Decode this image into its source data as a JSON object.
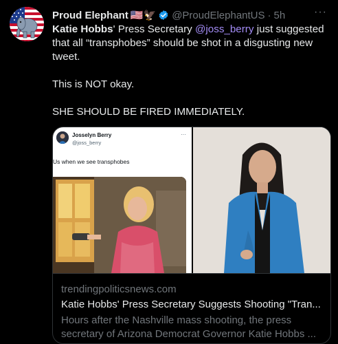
{
  "author": {
    "display_name": "Proud Elephant",
    "name_emojis": "🇺🇸🦅",
    "handle": "@ProudElephantUS",
    "separator": "·",
    "time": "5h",
    "verified": true,
    "avatar_icon": "elephant-flag-logo"
  },
  "tweet": {
    "line1_bold": "Katie Hobbs",
    "line1_rest": "' Press Secretary ",
    "mention": "@joss_berry",
    "line1_after": " just suggested that all “transphobes” should be shot in a disgusting new tweet.",
    "para2": "This is NOT okay.",
    "para3": "SHE SHOULD BE FIRED IMMEDIATELY."
  },
  "embedded_post": {
    "name": "Josselyn Berry",
    "handle": "@joss_berry",
    "more": "···",
    "text": "Us when we see transphobes"
  },
  "link_card": {
    "domain": "trendingpoliticsnews.com",
    "title": "Katie Hobbs' Press Secretary Suggests Shooting \"Tran...",
    "desc_line1": "Hours after the Nashville mass shooting, the press",
    "desc_line2": "secretary of Arizona Democrat Governor Katie Hobbs ..."
  },
  "ui": {
    "more_icon": "···"
  },
  "colors": {
    "background": "#000000",
    "text_primary": "#e7e9ea",
    "text_secondary": "#71767b",
    "mention": "#a38cf5",
    "verified": "#1d9bf0",
    "border": "#2f3336"
  }
}
